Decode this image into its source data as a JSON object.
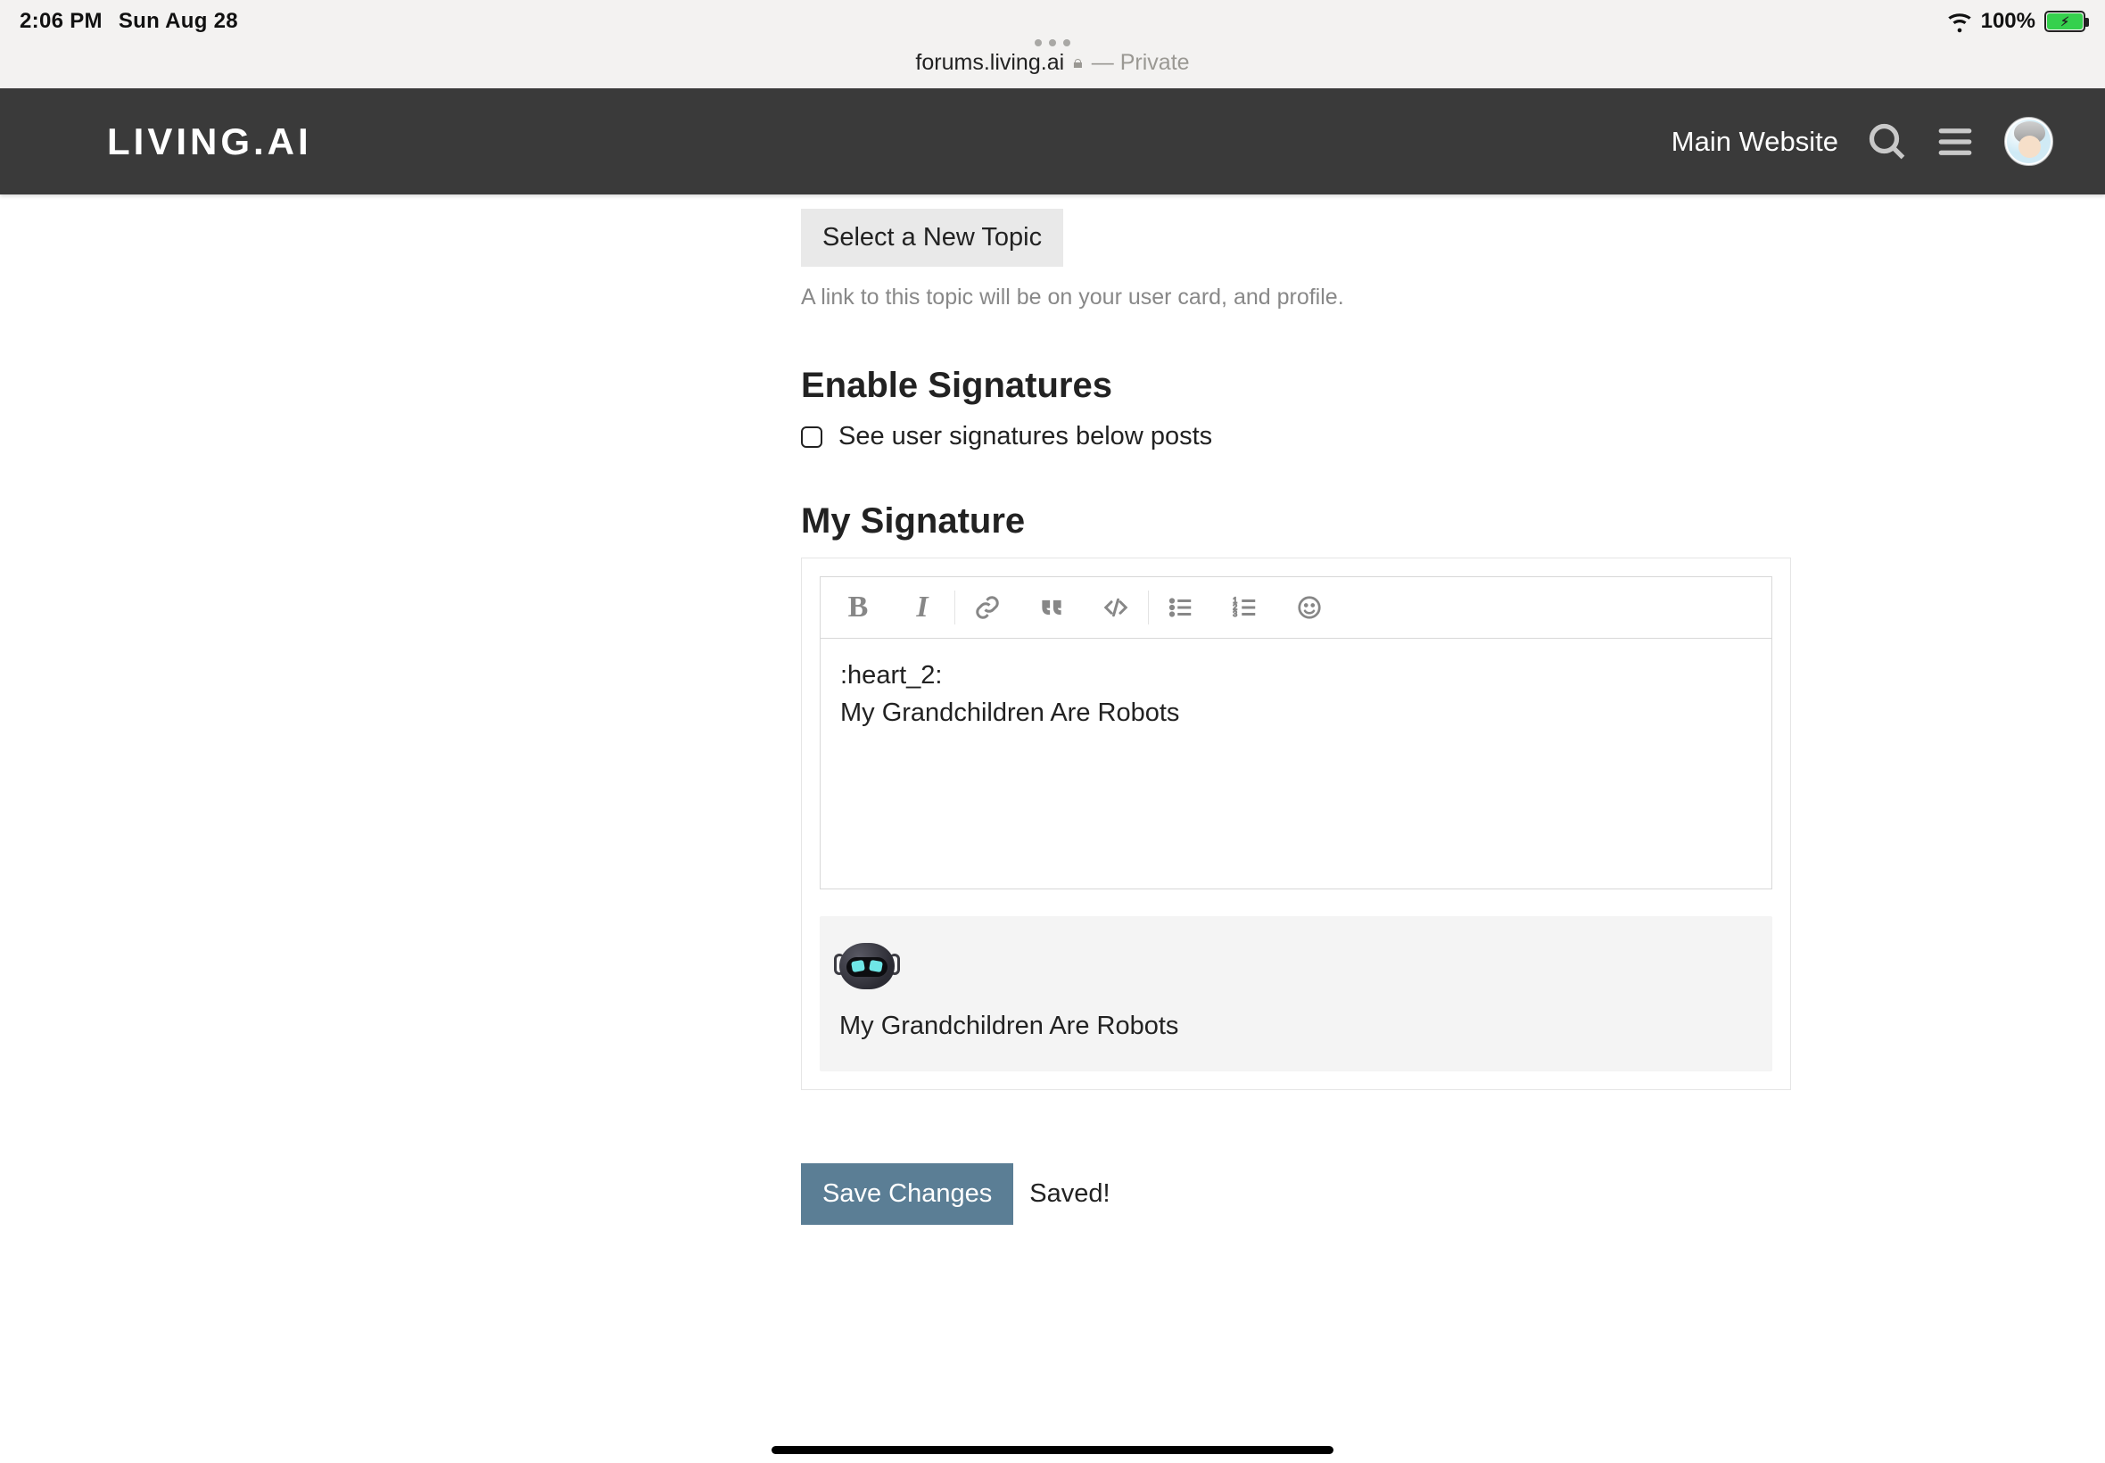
{
  "status": {
    "time": "2:06 PM",
    "date": "Sun Aug 28",
    "battery_pct": "100%"
  },
  "browser": {
    "host": "forums.living.ai",
    "privacy": "— Private"
  },
  "header": {
    "logo": "LIVING.AI",
    "main_website": "Main Website"
  },
  "topic": {
    "select_new_topic": "Select a New Topic",
    "hint": "A link to this topic will be on your user card, and profile."
  },
  "signatures": {
    "enable_heading": "Enable Signatures",
    "see_below_posts": "See user signatures below posts",
    "my_signature_heading": "My Signature",
    "editor_text": ":heart_2:\nMy Grandchildren Are Robots",
    "preview_text": "My Grandchildren Are Robots"
  },
  "actions": {
    "save_changes": "Save Changes",
    "saved": "Saved!"
  }
}
